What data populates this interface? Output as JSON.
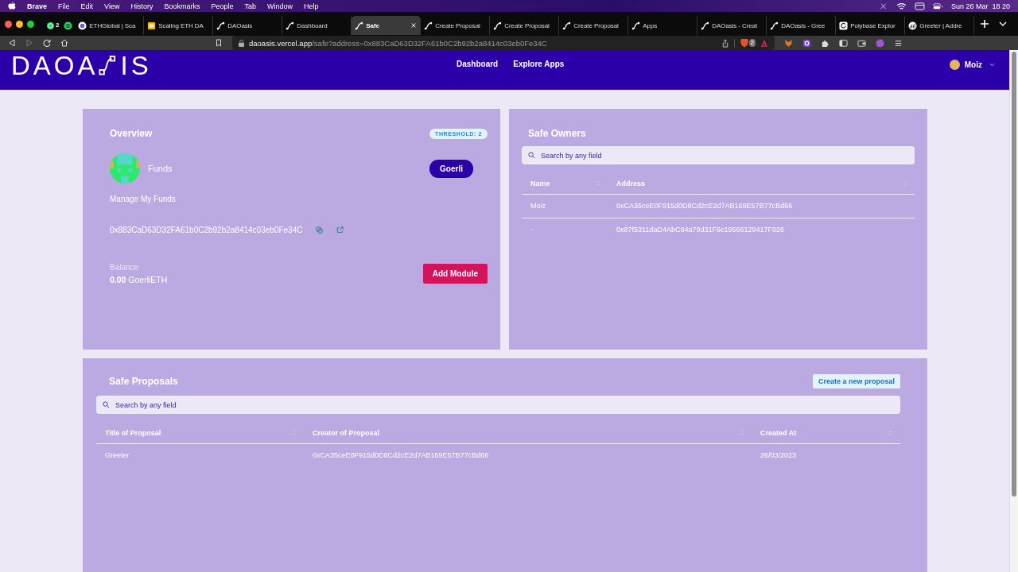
{
  "menubar": {
    "app": "Brave",
    "items": [
      "File",
      "Edit",
      "View",
      "History",
      "Bookmarks",
      "People",
      "Tab",
      "Window",
      "Help"
    ],
    "clock": "Sun 26 Mar  18 20"
  },
  "tabs": [
    {
      "kind": "chat",
      "badge": "2",
      "selected": false
    },
    {
      "kind": "music",
      "selected": false
    },
    {
      "kind": "globe",
      "title": "ETHGlobal | Sca",
      "selected": false
    },
    {
      "kind": "slides",
      "title": "Scaling ETH DA",
      "selected": false
    },
    {
      "kind": "link",
      "title": "DAOasis",
      "selected": false
    },
    {
      "kind": "link",
      "title": "Dashboard",
      "selected": false
    },
    {
      "kind": "link",
      "title": "Safe",
      "selected": true
    },
    {
      "kind": "link",
      "title": "Create Proposal",
      "selected": false
    },
    {
      "kind": "link",
      "title": "Create Proposal",
      "selected": false
    },
    {
      "kind": "link",
      "title": "Create Proposal",
      "selected": false
    },
    {
      "kind": "link",
      "title": "Apps",
      "selected": false
    },
    {
      "kind": "link",
      "title": "DAOasis - Creat",
      "selected": false
    },
    {
      "kind": "link",
      "title": "DAOasis - Gree",
      "selected": false
    },
    {
      "kind": "refresh",
      "title": "Polybase Explor",
      "selected": false
    },
    {
      "kind": "chart",
      "title": "Greeter | Addre",
      "selected": false
    }
  ],
  "address_bar": {
    "host": "daoasis.vercel.app",
    "path": "/safe?address=0x883CaD63D32FA61b0C2b92b2a8414c03eb0Fe34C",
    "shield_badge": "2"
  },
  "header": {
    "logo_left": "DAOA",
    "logo_right": "IS",
    "nav": [
      "Dashboard",
      "Explore Apps"
    ],
    "user": "Moiz"
  },
  "overview": {
    "title": "Overview",
    "threshold": "THRESHOLD: 2",
    "name": "Funds",
    "network": "Goerli",
    "subtitle": "Manage My Funds",
    "address": "0x883CaD63D32FA61b0C2b92b2a8414c03eb0Fe34C",
    "balance_label": "Balance",
    "balance_value": "0.00",
    "balance_unit": "GoerliETH",
    "button": "Add Module"
  },
  "owners": {
    "title": "Safe Owners",
    "search": {
      "placeholder": "Search by any field"
    },
    "columns": [
      "Name",
      "Address"
    ],
    "rows": [
      [
        "Moiz",
        "0xCA35ceE0F915d0D8Cd2cE2d7AB169E57B77cBd66"
      ],
      [
        "-",
        "0x87f5311daD4AbC84a79d31F6c19566129417F026"
      ]
    ]
  },
  "proposals": {
    "title": "Safe Proposals",
    "button": "Create a new proposal",
    "search": {
      "placeholder": "Search by any field"
    },
    "columns": [
      "Title of Proposal",
      "Creator of Proposal",
      "Created At"
    ],
    "rows": [
      [
        "Greeter",
        "0xCA35ceE0F915d0D8Cd2cE2d7AB169E57B77cBd66",
        "26/03/2023"
      ]
    ]
  }
}
